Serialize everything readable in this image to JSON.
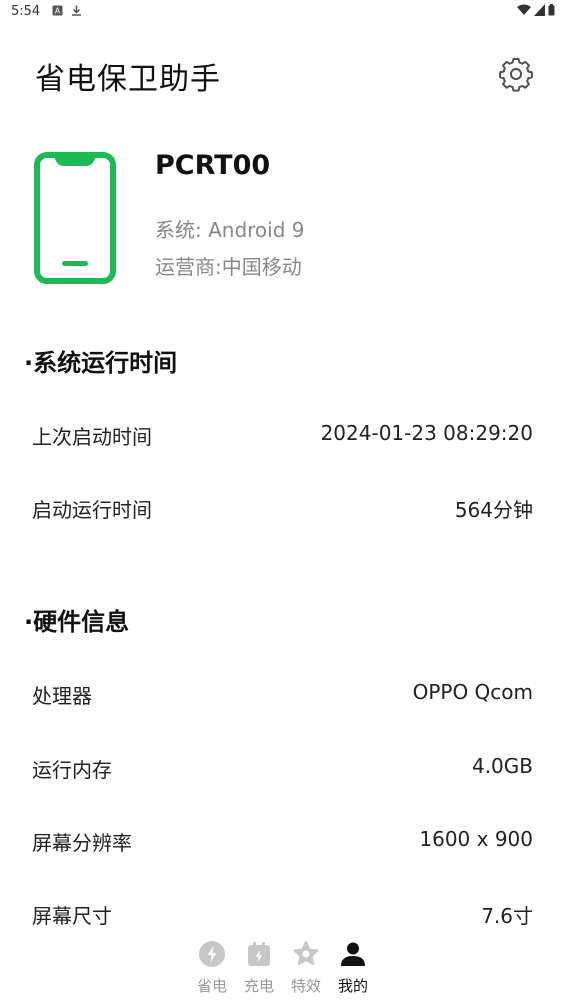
{
  "status_bar": {
    "time": "5:54"
  },
  "header": {
    "title": "省电保卫助手"
  },
  "device": {
    "name": "PCRT00",
    "os": "系统: Android 9",
    "carrier": "运营商:中国移动"
  },
  "colors": {
    "accent": "#1DB954",
    "text_primary": "#111111",
    "text_muted": "#888888",
    "nav_inactive": "#C7C7C7"
  },
  "sections": {
    "runtime": {
      "title": "·系统运行时间",
      "rows": [
        {
          "label": "上次启动时间",
          "value": "2024-01-23 08:29:20"
        },
        {
          "label": "启动运行时间",
          "value": "564分钟"
        }
      ]
    },
    "hardware": {
      "title": "·硬件信息",
      "rows": [
        {
          "label": "处理器",
          "value": "OPPO Qcom"
        },
        {
          "label": "运行内存",
          "value": "4.0GB"
        },
        {
          "label": "屏幕分辨率",
          "value": "1600 x 900"
        },
        {
          "label": "屏幕尺寸",
          "value": "7.6寸"
        }
      ]
    }
  },
  "bottom_nav": {
    "items": [
      {
        "label": "省电",
        "icon": "lightning-icon",
        "active": false
      },
      {
        "label": "充电",
        "icon": "calendar-icon",
        "active": false
      },
      {
        "label": "特效",
        "icon": "star-icon",
        "active": false
      },
      {
        "label": "我的",
        "icon": "person-icon",
        "active": true
      }
    ]
  }
}
